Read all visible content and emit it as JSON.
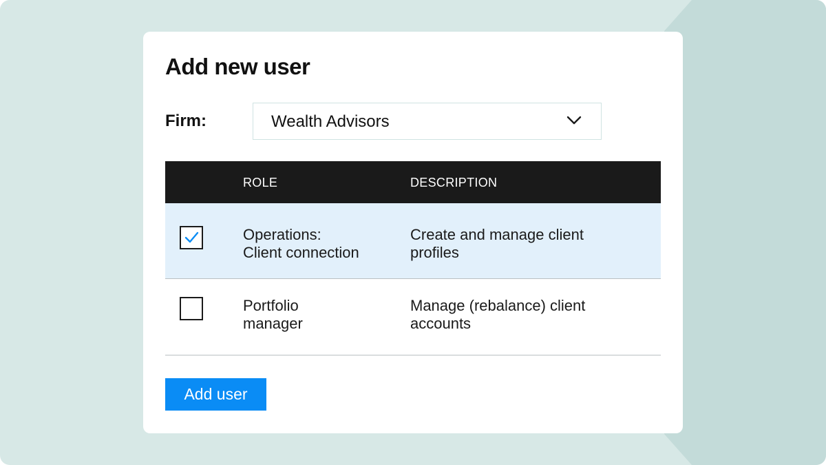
{
  "dialog": {
    "title": "Add new user"
  },
  "firm": {
    "label": "Firm:",
    "selected": "Wealth Advisors",
    "dropdown_icon": "chevron-down-icon"
  },
  "roles_table": {
    "columns": [
      "",
      "ROLE",
      "DESCRIPTION"
    ],
    "rows": [
      {
        "checked": true,
        "role_line1": "Operations:",
        "role_line2": "Client connection",
        "desc_line1": "Create and manage client",
        "desc_line2": "profiles"
      },
      {
        "checked": false,
        "role_line1": "Portfolio",
        "role_line2": "manager",
        "desc_line1": "Manage (rebalance) client",
        "desc_line2": "accounts"
      }
    ]
  },
  "actions": {
    "add_user_label": "Add user"
  },
  "colors": {
    "background": "#d7e8e6",
    "background_shape": "#c3dbd9",
    "header_bg": "#1a1a1a",
    "selected_row_bg": "#e2f0fb",
    "accent": "#0a8cf5"
  }
}
